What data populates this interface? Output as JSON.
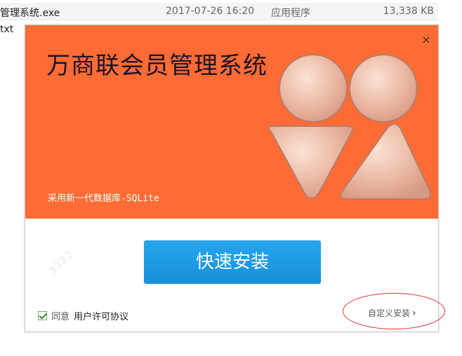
{
  "explorer": {
    "row1": {
      "name": "管理系统.exe",
      "date": "2017-07-26 16:20",
      "type": "应用程序",
      "size": "13,338 KB"
    },
    "row2": {
      "name": "txt"
    }
  },
  "dialog": {
    "close_glyph": "×",
    "banner": {
      "title": "万商联会员管理系统",
      "subtitle": "采用新一代数据库-SQLite",
      "background_color": "#ff6b35"
    },
    "install_button": "快速安装",
    "agree": {
      "label": "同意",
      "license_link": "用户许可协议",
      "checked": true
    },
    "custom_install": {
      "label": "自定义安装",
      "chevron": "›"
    }
  },
  "icons": [
    "close-icon",
    "checkbox-check-icon",
    "chevron-right-icon",
    "app-logo-icon"
  ],
  "colors": {
    "accent_blue": "#1a9be6",
    "banner_orange": "#ff6b35",
    "annotation_red": "#e0302a"
  }
}
